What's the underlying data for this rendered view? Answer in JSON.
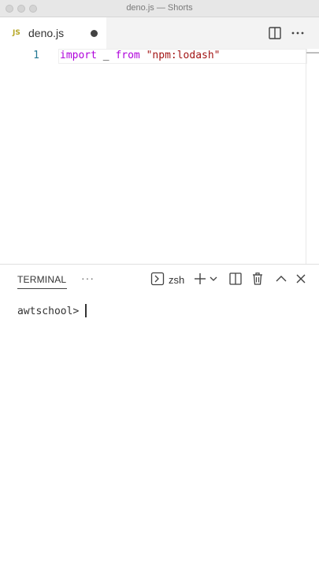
{
  "window": {
    "title": "deno.js — Shorts"
  },
  "tab": {
    "badge": "JS",
    "name": "deno.js"
  },
  "editor": {
    "line_number": "1",
    "tokens": {
      "keyword1": "import",
      "identifier": " _ ",
      "keyword2": "from",
      "space": " ",
      "string": "\"npm:lodash\""
    }
  },
  "panel": {
    "tab_label": "TERMINAL",
    "more": "···",
    "shell": "zsh",
    "prompt": "awtschool> "
  },
  "icons": [
    "split-editor-icon",
    "more-actions-icon",
    "terminal-shell-icon",
    "add-terminal-icon",
    "chevron-down-icon",
    "split-terminal-icon",
    "trash-icon",
    "maximize-panel-icon",
    "close-panel-icon"
  ]
}
